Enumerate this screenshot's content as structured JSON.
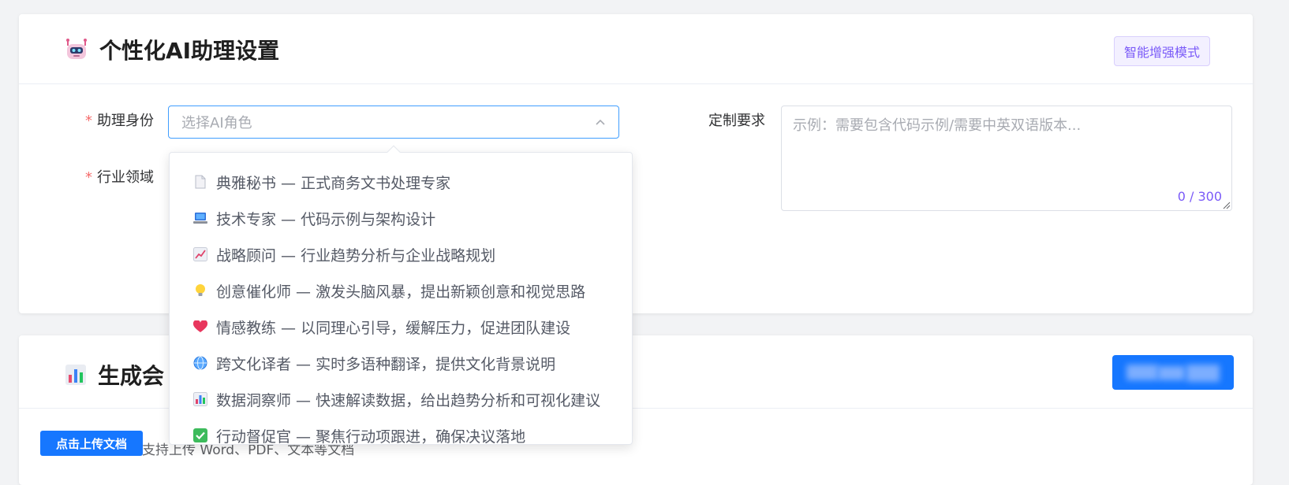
{
  "settings_card": {
    "title": "个性化AI助理设置",
    "badge": "智能增强模式",
    "assistant_identity": {
      "required_mark": "*",
      "label": "助理身份",
      "placeholder": "选择AI角色"
    },
    "industry": {
      "required_mark": "*",
      "label": "行业领域"
    },
    "custom_requirements": {
      "label": "定制要求",
      "placeholder": "示例：需要包含代码示例/需要中英双语版本...",
      "counter": "0 / 300"
    }
  },
  "role_options": [
    {
      "icon": "document-icon",
      "label": "典雅秘书 — 正式商务文书处理专家"
    },
    {
      "icon": "laptop-icon",
      "label": "技术专家 — 代码示例与架构设计"
    },
    {
      "icon": "chart-up-icon",
      "label": "战略顾问 — 行业趋势分析与企业战略规划"
    },
    {
      "icon": "lightbulb-icon",
      "label": "创意催化师 — 激发头脑风暴，提出新颖创意和视觉思路"
    },
    {
      "icon": "heart-icon",
      "label": "情感教练 — 以同理心引导，缓解压力，促进团队建设"
    },
    {
      "icon": "globe-icon",
      "label": "跨文化译者 — 实时多语种翻译，提供文化背景说明"
    },
    {
      "icon": "bar-chart-icon",
      "label": "数据洞察师 — 快速解读数据，给出趋势分析和可视化建议"
    },
    {
      "icon": "check-icon",
      "label": "行动督促官 — 聚焦行动项跟进，确保决议落地"
    }
  ],
  "generate_card": {
    "title": "生成会",
    "upload_button": "点击上传文档",
    "upload_hint": "支持上传 Word、PDF、文本等文档"
  },
  "colors": {
    "primary": "#1677ff",
    "focus_border": "#409eff",
    "accent_purple": "#7a5af8",
    "required": "#f56c6c"
  }
}
